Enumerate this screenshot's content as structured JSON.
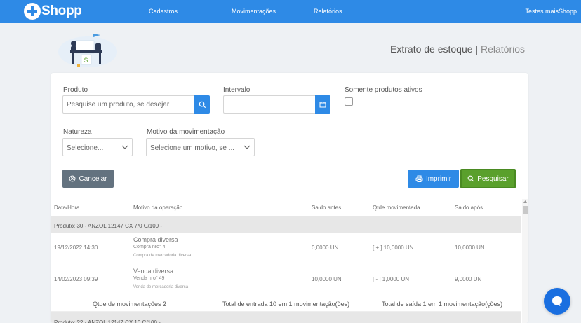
{
  "app": {
    "logo_text": "Shopp"
  },
  "nav": {
    "items": [
      "Cadastros",
      "Movimentações",
      "Relatórios"
    ],
    "user": "Testes maisShopp"
  },
  "page": {
    "title": "Extrato de estoque",
    "separator": "|",
    "subtitle": "Relatórios"
  },
  "filters": {
    "produto_label": "Produto",
    "produto_placeholder": "Pesquise um produto, se desejar",
    "intervalo_label": "Intervalo",
    "intervalo_value": "",
    "ativos_label": "Somente produtos ativos",
    "natureza_label": "Natureza",
    "natureza_value": "Selecione...",
    "motivo_label": "Motivo da movimentação",
    "motivo_value": "Selecione um motivo, se ..."
  },
  "buttons": {
    "cancel": "Cancelar",
    "print": "Imprimir",
    "search": "Pesquisar"
  },
  "table": {
    "headers": [
      "Data/Hora",
      "Motivo da operação",
      "Saldo antes",
      "Qtde movimentada",
      "Saldo após"
    ],
    "groups": [
      {
        "product": "Produto: 30 - ANZOL 12147 CX 7/0 C/100 -",
        "rows": [
          {
            "datetime": "19/12/2022 14:30",
            "motivo": "Compra diversa",
            "ref": "Compra nro° 4",
            "desc": "Compra de mercadoria diversa",
            "saldo_antes": "0,0000 UN",
            "qtde": "[ + ] 10,0000 UN",
            "saldo_apos": "10,0000 UN"
          },
          {
            "datetime": "14/02/2023 09:39",
            "motivo": "Venda diversa",
            "ref": "Venda nro° 49",
            "desc": "Venda de mercadoria diversa",
            "saldo_antes": "10,0000 UN",
            "qtde": "[ - ] 1,0000 UN",
            "saldo_apos": "9,0000 UN"
          }
        ],
        "summary": {
          "count": "Qtde de movimentações 2",
          "entrada": "Total de entrada 10 em 1 movimentação(ões)",
          "saida": "Total de saída 1 em 1 movimentação(ções)"
        }
      },
      {
        "product": "Produto: 22 - ANZOL 12147 CX 10 C/100 -"
      }
    ]
  },
  "colors": {
    "primary": "#2e8ae6",
    "success": "#5aa02c",
    "cancel": "#63727f",
    "chat": "#1a6fe0"
  }
}
